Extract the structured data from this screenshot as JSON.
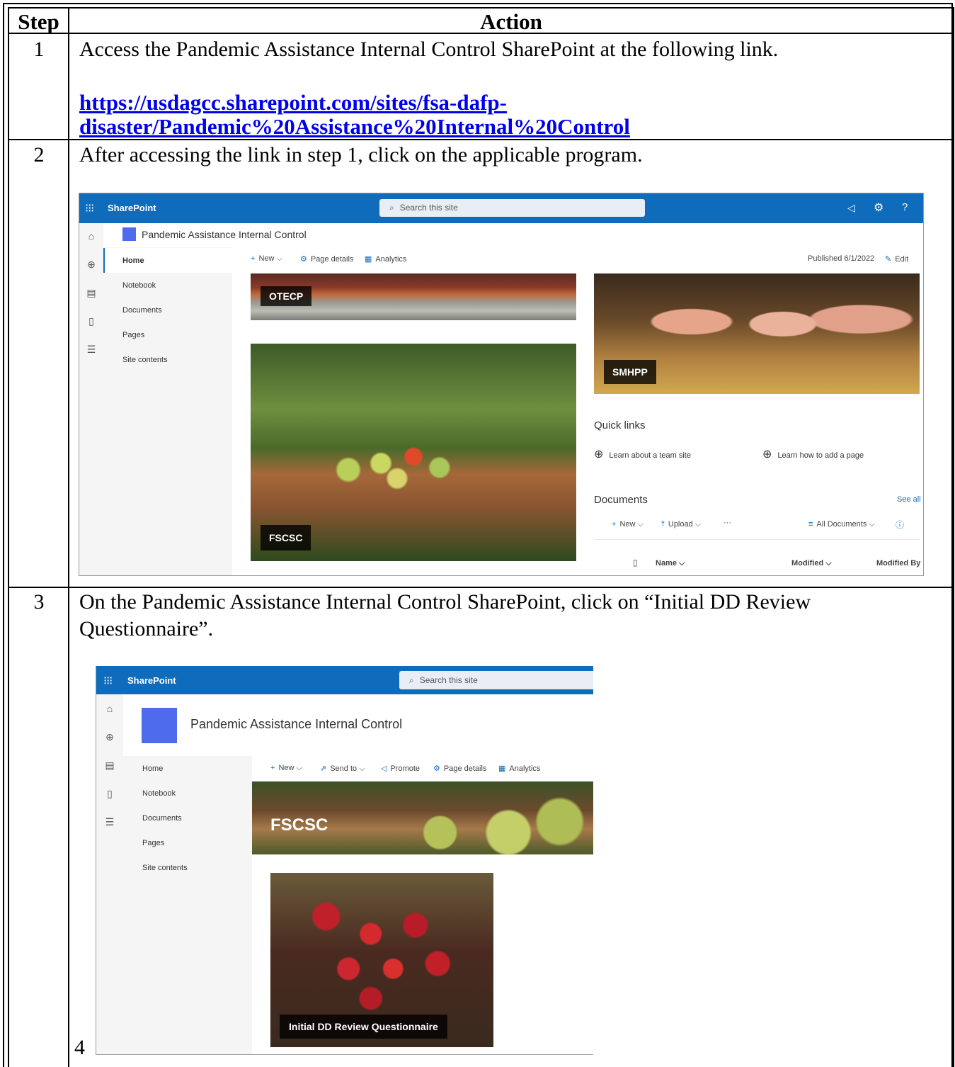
{
  "table": {
    "header_step": "Step",
    "header_action": "Action",
    "rows": [
      {
        "step": "1",
        "text": "Access the Pandemic Assistance Internal Control SharePoint at the following link.",
        "link_line1": "https://usdagcc.sharepoint.com/sites/fsa-dafp-",
        "link_line2": "disaster/Pandemic%20Assistance%20Internal%20Control"
      },
      {
        "step": "2",
        "text": "After accessing the link in step 1, click on the applicable program."
      },
      {
        "step": "3",
        "text_line1": "On the Pandemic Assistance Internal Control SharePoint, click on “Initial DD Review",
        "text_line2": "Questionnaire”."
      },
      {
        "step": "4"
      }
    ]
  },
  "shot1": {
    "brand": "SharePoint",
    "search_placeholder": "Search this site",
    "site_title": "Pandemic Assistance Internal Control",
    "nav": [
      "Home",
      "Notebook",
      "Documents",
      "Pages",
      "Site contents"
    ],
    "cmd_new": "New",
    "cmd_page_details": "Page details",
    "cmd_analytics": "Analytics",
    "published": "Published 6/1/2022",
    "edit": "Edit",
    "tiles": {
      "otecp": "OTECP",
      "smhpp": "SMHPP",
      "fscsc": "FSCSC"
    },
    "quick_links_title": "Quick links",
    "quick_link_1": "Learn about a team site",
    "quick_link_2": "Learn how to add a page",
    "documents_title": "Documents",
    "see_all": "See all",
    "doc_new": "New",
    "doc_upload": "Upload",
    "doc_more": "···",
    "all_documents": "All Documents",
    "col_name": "Name",
    "col_modified": "Modified",
    "col_modified_by": "Modified By"
  },
  "shot2": {
    "brand": "SharePoint",
    "search_placeholder": "Search this site",
    "site_title": "Pandemic Assistance Internal Control",
    "nav": [
      "Home",
      "Notebook",
      "Documents",
      "Pages",
      "Site contents"
    ],
    "cmd_new": "New",
    "cmd_send_to": "Send to",
    "cmd_promote": "Promote",
    "cmd_page_details": "Page details",
    "cmd_analytics": "Analytics",
    "banner": "FSCSC",
    "tile_label": "Initial DD Review Questionnaire"
  },
  "colors": {
    "suite_bar": "#0f6cbd",
    "site_logo": "#4f6bed",
    "link": "#0000ee"
  }
}
